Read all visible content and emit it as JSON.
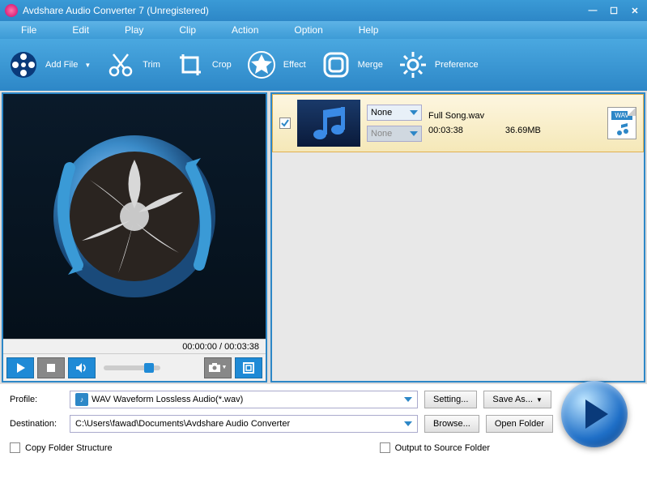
{
  "titlebar": {
    "title": "Avdshare Audio Converter 7 (Unregistered)"
  },
  "menu": {
    "file": "File",
    "edit": "Edit",
    "play": "Play",
    "clip": "Clip",
    "action": "Action",
    "option": "Option",
    "help": "Help"
  },
  "toolbar": {
    "addfile": "Add File",
    "trim": "Trim",
    "crop": "Crop",
    "effect": "Effect",
    "merge": "Merge",
    "preference": "Preference"
  },
  "player": {
    "time": "00:00:00 / 00:03:38"
  },
  "file": {
    "name": "Full Song.wav",
    "duration": "00:03:38",
    "size": "36.69MB",
    "format_badge": "WAV",
    "dd1": "None",
    "dd2": "None"
  },
  "profile": {
    "label": "Profile:",
    "value": "WAV Waveform Lossless Audio(*.wav)",
    "setting": "Setting...",
    "saveas": "Save As..."
  },
  "dest": {
    "label": "Destination:",
    "value": "C:\\Users\\fawad\\Documents\\Avdshare Audio Converter",
    "browse": "Browse...",
    "open": "Open Folder"
  },
  "opts": {
    "copy_structure": "Copy Folder Structure",
    "output_source": "Output to Source Folder"
  }
}
